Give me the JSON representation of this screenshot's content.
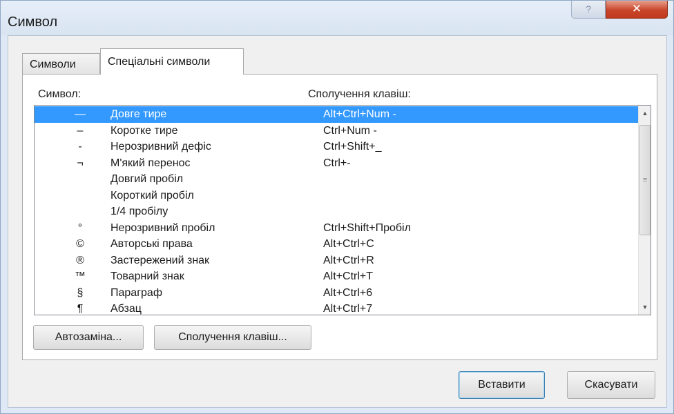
{
  "window": {
    "title": "Символ",
    "help_glyph": "?",
    "close_glyph": "✕"
  },
  "tabs": [
    {
      "label": "Символи",
      "active": false
    },
    {
      "label": "Спеціальні символи",
      "active": true
    }
  ],
  "list": {
    "symbol_header": "Символ:",
    "shortcut_header": "Сполучення клавіш:",
    "selected_index": 0,
    "rows": [
      {
        "symbol": "—",
        "name": "Довге тире",
        "shortcut": "Alt+Ctrl+Num -"
      },
      {
        "symbol": "–",
        "name": "Коротке тире",
        "shortcut": "Ctrl+Num -"
      },
      {
        "symbol": "-",
        "name": "Нерозривний дефіс",
        "shortcut": "Ctrl+Shift+_"
      },
      {
        "symbol": "¬",
        "name": "М'який перенос",
        "shortcut": "Ctrl+-"
      },
      {
        "symbol": "",
        "name": "Довгий пробіл",
        "shortcut": ""
      },
      {
        "symbol": "",
        "name": "Короткий пробіл",
        "shortcut": ""
      },
      {
        "symbol": "",
        "name": "1/4 пробілу",
        "shortcut": ""
      },
      {
        "symbol": "°",
        "name": "Нерозривний пробіл",
        "shortcut": "Ctrl+Shift+Пробіл"
      },
      {
        "symbol": "©",
        "name": "Авторські права",
        "shortcut": "Alt+Ctrl+C"
      },
      {
        "symbol": "®",
        "name": "Застережений знак",
        "shortcut": "Alt+Ctrl+R"
      },
      {
        "symbol": "™",
        "name": "Товарний знак",
        "shortcut": "Alt+Ctrl+T"
      },
      {
        "symbol": "§",
        "name": "Параграф",
        "shortcut": "Alt+Ctrl+6"
      },
      {
        "symbol": "¶",
        "name": "Абзац",
        "shortcut": "Alt+Ctrl+7"
      }
    ]
  },
  "buttons": {
    "autocorrect": "Автозаміна...",
    "shortcut_key": "Сполучення клавіш...",
    "insert": "Вставити",
    "cancel": "Скасувати"
  },
  "scrollbar": {
    "up_glyph": "▲",
    "down_glyph": "▼",
    "thumb_glyph": "≡"
  }
}
